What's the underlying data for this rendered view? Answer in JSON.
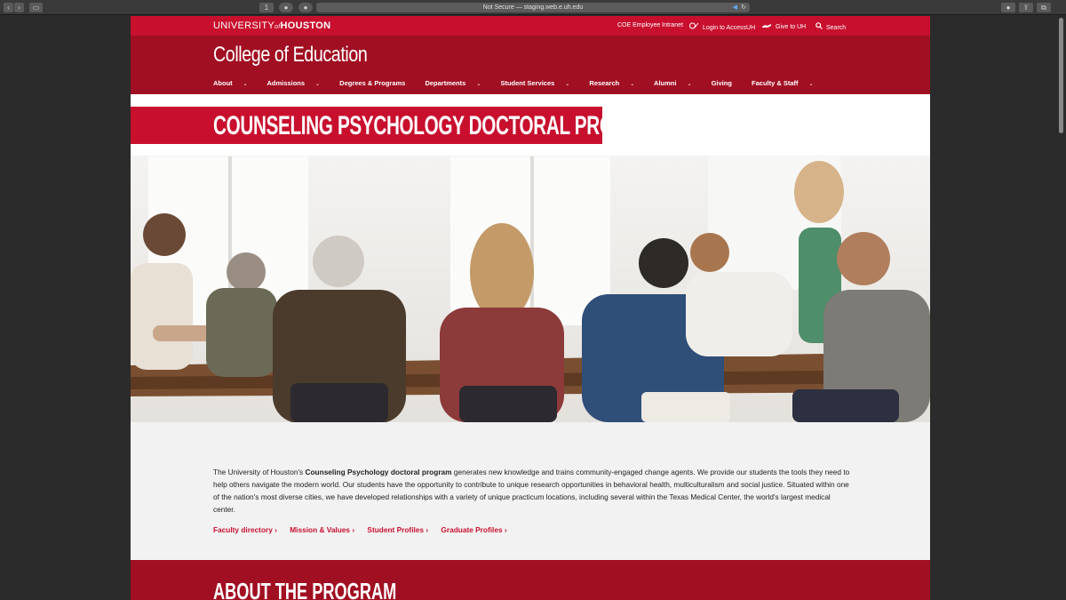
{
  "browser": {
    "url": "Not Secure — staging.web.e.uh.edu",
    "tab_count": "1"
  },
  "topbar": {
    "logo_part1": "UNIVERSITY",
    "logo_of": "of",
    "logo_part2": "HOUSTON",
    "links": [
      {
        "label": "COE Employee Intranet",
        "icon": ""
      },
      {
        "label": "Login to AccessUH",
        "icon": "accessuh-icon"
      },
      {
        "label": "Give to UH",
        "icon": "give-hand-icon"
      },
      {
        "label": "Search",
        "icon": "search-icon"
      }
    ]
  },
  "header": {
    "college": "College of Education",
    "nav": [
      {
        "label": "About"
      },
      {
        "label": "Admissions"
      },
      {
        "label": "Degrees & Programs"
      },
      {
        "label": "Departments"
      },
      {
        "label": "Student Services"
      },
      {
        "label": "Research"
      },
      {
        "label": "Alumni"
      },
      {
        "label": "Giving"
      },
      {
        "label": "Faculty & Staff"
      }
    ]
  },
  "page_title": "COUNSELING PSYCHOLOGY DOCTORAL PROGRAM",
  "intro": {
    "part1": "The University of Houston's ",
    "bold": "Counseling Psychology doctoral program",
    "part2": " generates new knowledge and trains community-engaged change agents. We provide our students the tools they need to help others navigate the modern world. Our students have the opportunity to contribute to unique research opportunities in behavioral health, multiculturalism and social justice. Situated within one of the nation's most diverse cities, we have developed relationships with a variety of unique practicum locations, including several within the Texas Medical Center, the world's largest medical center."
  },
  "quick_links": [
    {
      "label": "Faculty directory ›"
    },
    {
      "label": "Mission & Values ›"
    },
    {
      "label": "Student Profiles ›"
    },
    {
      "label": "Graduate Profiles ›"
    }
  ],
  "about_title": "ABOUT THE PROGRAM",
  "colors": {
    "uh_red": "#c8102e",
    "uh_dark_red": "#a10f22"
  }
}
